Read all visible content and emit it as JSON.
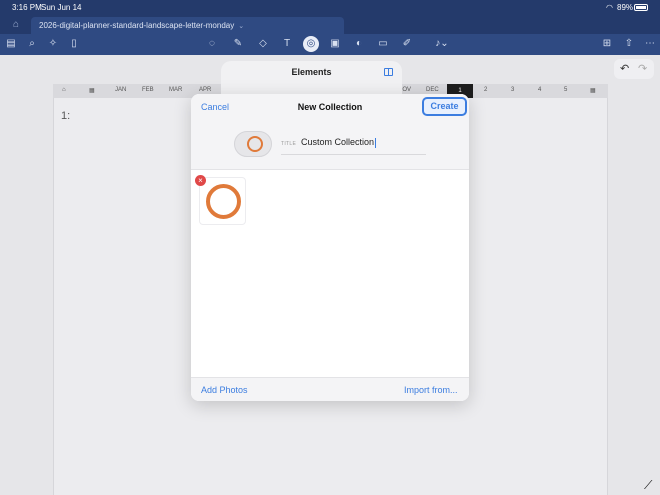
{
  "status_bar": {
    "time": "3:16 PM",
    "date": "Sun Jun 14",
    "battery": "89%"
  },
  "tab": {
    "title": "2026-digital-planner-standard-landscape-letter-monday",
    "chevron": "⌄"
  },
  "toolbar": {
    "icons": [
      "sidebar-icon",
      "search-icon",
      "bookmark-add-icon",
      "document-icon",
      "lasso-icon",
      "pen-icon",
      "eraser-icon",
      "text-icon",
      "elements-icon",
      "image-icon",
      "shapes-icon",
      "sticky-note-icon",
      "highlighter-icon",
      "microphone-icon",
      "export-icon",
      "share-icon",
      "more-icon"
    ],
    "active_icon": "elements-icon"
  },
  "planner": {
    "months": [
      "JAN",
      "FEB",
      "MAR",
      "APR",
      "NOV",
      "DEC"
    ],
    "days": [
      "1",
      "2",
      "3",
      "4",
      "5"
    ],
    "line_label": "1:"
  },
  "elements_panel": {
    "title": "Elements"
  },
  "modal": {
    "cancel_label": "Cancel",
    "title": "New Collection",
    "create_label": "Create",
    "title_field_label": "TITLE",
    "title_value": "Custom Collection",
    "add_photos_label": "Add Photos",
    "import_label": "Import from...",
    "remove_glyph": "×"
  },
  "colors": {
    "accent": "#3b7de0",
    "header_dark": "#243a6b",
    "toolbar": "#2f4a82",
    "ring_orange": "#e07a3a",
    "remove_red": "#e04848"
  }
}
